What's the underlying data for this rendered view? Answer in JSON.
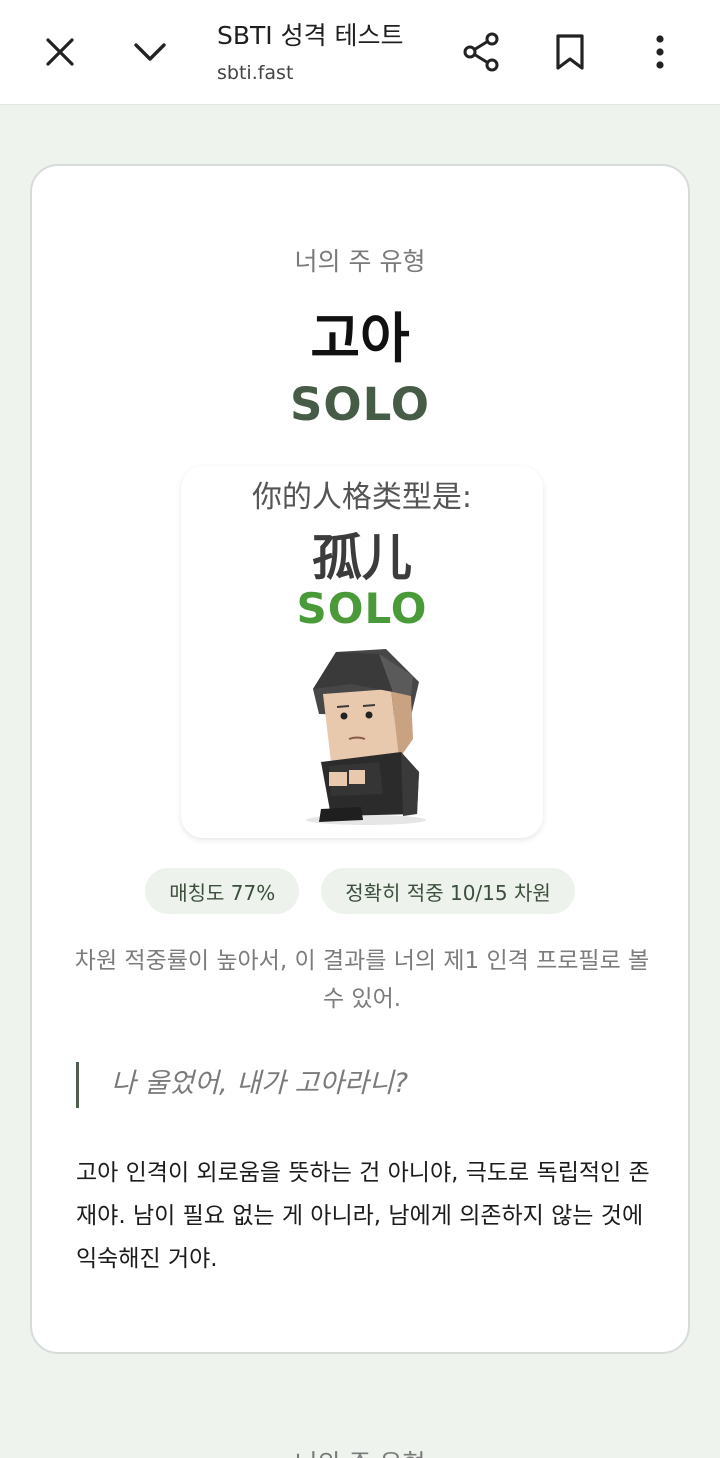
{
  "topbar": {
    "title": "SBTI 성격 테스트",
    "url": "sbti.fast",
    "icons": [
      "close-icon",
      "chevron-down-icon",
      "share-icon",
      "bookmark-icon",
      "more-vert-icon"
    ]
  },
  "result": {
    "subtitle": "너의 주 유형",
    "type_name": "고아",
    "type_code": "SOLO",
    "image": {
      "caption": "你的人格类型是:",
      "name": "孤儿",
      "code": "SOLO"
    },
    "badges": {
      "match": "매칭도 77%",
      "dimensions": "정확히 적중 10/15 차원"
    },
    "note": "차원 적중률이 높아서, 이 결과를 너의 제1 인격 프로필로 볼 수 있어.",
    "quote": "나 울었어, 내가 고아라니?",
    "description": "고아 인격이 외로움을 뜻하는 건 아니야, 극도로 독립적인 존재야. 남이 필요 없는 게 아니라, 남에게 의존하지 않는 것에 익숙해진 거야."
  },
  "next_section": {
    "subtitle": "너의 주 유형"
  },
  "colors": {
    "background": "#eef3ee",
    "accent": "#475c47",
    "image_code_green": "#4a9a3a",
    "badge_bg": "#edf2ec"
  }
}
